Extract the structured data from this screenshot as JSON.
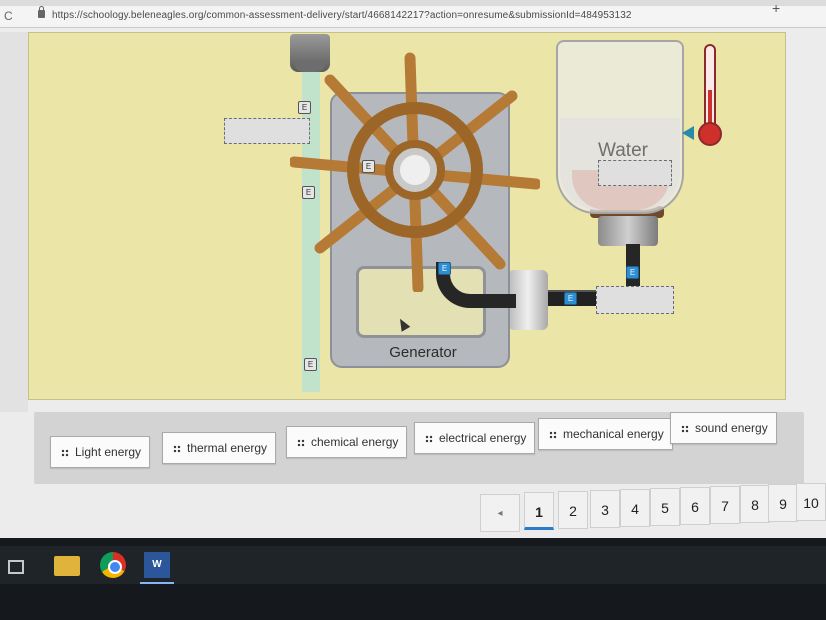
{
  "browser": {
    "url": "https://schoology.beleneagles.org/common-assessment-delivery/start/4668142217?action=onresume&submissionId=484953132"
  },
  "scene": {
    "generator_label": "Generator",
    "water_label": "Water",
    "e_marker": "E"
  },
  "word_bank": {
    "items": [
      {
        "label": "Light energy"
      },
      {
        "label": "thermal energy"
      },
      {
        "label": "chemical energy"
      },
      {
        "label": "electrical energy"
      },
      {
        "label": "mechanical energy"
      },
      {
        "label": "sound energy"
      }
    ]
  },
  "pager": {
    "prev": "◂",
    "pages": [
      "1",
      "2",
      "3",
      "4",
      "5",
      "6",
      "7",
      "8",
      "9",
      "10"
    ],
    "current": "1"
  },
  "taskbar": {
    "word_app_label": "W"
  },
  "colors": {
    "scene_bg": "#ebe6a7",
    "wheel_wood": "#b57a35",
    "accent_blue": "#2b7bc9"
  }
}
